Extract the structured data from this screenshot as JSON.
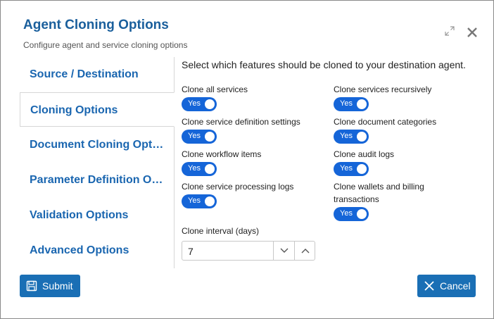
{
  "dialog": {
    "title": "Agent Cloning Options",
    "subtitle": "Configure agent and service cloning options"
  },
  "sidebar": {
    "items": [
      {
        "label": "Source / Destination"
      },
      {
        "label": "Cloning Options",
        "active": true
      },
      {
        "label": "Document Cloning Options"
      },
      {
        "label": "Parameter Definition Options"
      },
      {
        "label": "Validation Options"
      },
      {
        "label": "Advanced Options"
      }
    ]
  },
  "main": {
    "intro": "Select which features should be cloned to your destination agent.",
    "options": [
      {
        "label": "Clone all services",
        "value": "Yes"
      },
      {
        "label": "Clone services recursively",
        "value": "Yes"
      },
      {
        "label": "Clone service definition settings",
        "value": "Yes"
      },
      {
        "label": "Clone document categories",
        "value": "Yes"
      },
      {
        "label": "Clone workflow items",
        "value": "Yes"
      },
      {
        "label": "Clone audit logs",
        "value": "Yes"
      },
      {
        "label": "Clone service processing logs",
        "value": "Yes"
      },
      {
        "label": "Clone wallets and billing",
        "label2": "transactions",
        "value": "Yes"
      }
    ],
    "interval": {
      "label": "Clone interval (days)",
      "value": "7"
    }
  },
  "footer": {
    "submit_label": "Submit",
    "cancel_label": "Cancel"
  },
  "colors": {
    "accent": "#1a6fb5",
    "title": "#1a5f9c",
    "toggle_on": "#1565d8"
  },
  "icons": [
    "expand-icon",
    "close-icon",
    "save-icon",
    "cancel-x-icon",
    "chevron-down-icon",
    "chevron-up-icon"
  ]
}
